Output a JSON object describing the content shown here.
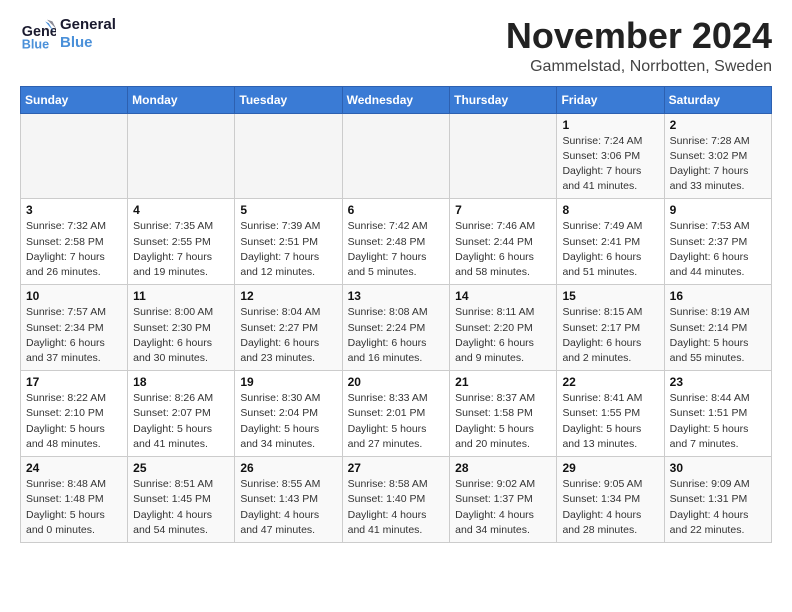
{
  "logo": {
    "line1": "General",
    "line2": "Blue"
  },
  "title": "November 2024",
  "location": "Gammelstad, Norrbotten, Sweden",
  "weekdays": [
    "Sunday",
    "Monday",
    "Tuesday",
    "Wednesday",
    "Thursday",
    "Friday",
    "Saturday"
  ],
  "weeks": [
    [
      {
        "day": "",
        "info": ""
      },
      {
        "day": "",
        "info": ""
      },
      {
        "day": "",
        "info": ""
      },
      {
        "day": "",
        "info": ""
      },
      {
        "day": "",
        "info": ""
      },
      {
        "day": "1",
        "info": "Sunrise: 7:24 AM\nSunset: 3:06 PM\nDaylight: 7 hours\nand 41 minutes."
      },
      {
        "day": "2",
        "info": "Sunrise: 7:28 AM\nSunset: 3:02 PM\nDaylight: 7 hours\nand 33 minutes."
      }
    ],
    [
      {
        "day": "3",
        "info": "Sunrise: 7:32 AM\nSunset: 2:58 PM\nDaylight: 7 hours\nand 26 minutes."
      },
      {
        "day": "4",
        "info": "Sunrise: 7:35 AM\nSunset: 2:55 PM\nDaylight: 7 hours\nand 19 minutes."
      },
      {
        "day": "5",
        "info": "Sunrise: 7:39 AM\nSunset: 2:51 PM\nDaylight: 7 hours\nand 12 minutes."
      },
      {
        "day": "6",
        "info": "Sunrise: 7:42 AM\nSunset: 2:48 PM\nDaylight: 7 hours\nand 5 minutes."
      },
      {
        "day": "7",
        "info": "Sunrise: 7:46 AM\nSunset: 2:44 PM\nDaylight: 6 hours\nand 58 minutes."
      },
      {
        "day": "8",
        "info": "Sunrise: 7:49 AM\nSunset: 2:41 PM\nDaylight: 6 hours\nand 51 minutes."
      },
      {
        "day": "9",
        "info": "Sunrise: 7:53 AM\nSunset: 2:37 PM\nDaylight: 6 hours\nand 44 minutes."
      }
    ],
    [
      {
        "day": "10",
        "info": "Sunrise: 7:57 AM\nSunset: 2:34 PM\nDaylight: 6 hours\nand 37 minutes."
      },
      {
        "day": "11",
        "info": "Sunrise: 8:00 AM\nSunset: 2:30 PM\nDaylight: 6 hours\nand 30 minutes."
      },
      {
        "day": "12",
        "info": "Sunrise: 8:04 AM\nSunset: 2:27 PM\nDaylight: 6 hours\nand 23 minutes."
      },
      {
        "day": "13",
        "info": "Sunrise: 8:08 AM\nSunset: 2:24 PM\nDaylight: 6 hours\nand 16 minutes."
      },
      {
        "day": "14",
        "info": "Sunrise: 8:11 AM\nSunset: 2:20 PM\nDaylight: 6 hours\nand 9 minutes."
      },
      {
        "day": "15",
        "info": "Sunrise: 8:15 AM\nSunset: 2:17 PM\nDaylight: 6 hours\nand 2 minutes."
      },
      {
        "day": "16",
        "info": "Sunrise: 8:19 AM\nSunset: 2:14 PM\nDaylight: 5 hours\nand 55 minutes."
      }
    ],
    [
      {
        "day": "17",
        "info": "Sunrise: 8:22 AM\nSunset: 2:10 PM\nDaylight: 5 hours\nand 48 minutes."
      },
      {
        "day": "18",
        "info": "Sunrise: 8:26 AM\nSunset: 2:07 PM\nDaylight: 5 hours\nand 41 minutes."
      },
      {
        "day": "19",
        "info": "Sunrise: 8:30 AM\nSunset: 2:04 PM\nDaylight: 5 hours\nand 34 minutes."
      },
      {
        "day": "20",
        "info": "Sunrise: 8:33 AM\nSunset: 2:01 PM\nDaylight: 5 hours\nand 27 minutes."
      },
      {
        "day": "21",
        "info": "Sunrise: 8:37 AM\nSunset: 1:58 PM\nDaylight: 5 hours\nand 20 minutes."
      },
      {
        "day": "22",
        "info": "Sunrise: 8:41 AM\nSunset: 1:55 PM\nDaylight: 5 hours\nand 13 minutes."
      },
      {
        "day": "23",
        "info": "Sunrise: 8:44 AM\nSunset: 1:51 PM\nDaylight: 5 hours\nand 7 minutes."
      }
    ],
    [
      {
        "day": "24",
        "info": "Sunrise: 8:48 AM\nSunset: 1:48 PM\nDaylight: 5 hours\nand 0 minutes."
      },
      {
        "day": "25",
        "info": "Sunrise: 8:51 AM\nSunset: 1:45 PM\nDaylight: 4 hours\nand 54 minutes."
      },
      {
        "day": "26",
        "info": "Sunrise: 8:55 AM\nSunset: 1:43 PM\nDaylight: 4 hours\nand 47 minutes."
      },
      {
        "day": "27",
        "info": "Sunrise: 8:58 AM\nSunset: 1:40 PM\nDaylight: 4 hours\nand 41 minutes."
      },
      {
        "day": "28",
        "info": "Sunrise: 9:02 AM\nSunset: 1:37 PM\nDaylight: 4 hours\nand 34 minutes."
      },
      {
        "day": "29",
        "info": "Sunrise: 9:05 AM\nSunset: 1:34 PM\nDaylight: 4 hours\nand 28 minutes."
      },
      {
        "day": "30",
        "info": "Sunrise: 9:09 AM\nSunset: 1:31 PM\nDaylight: 4 hours\nand 22 minutes."
      }
    ]
  ]
}
